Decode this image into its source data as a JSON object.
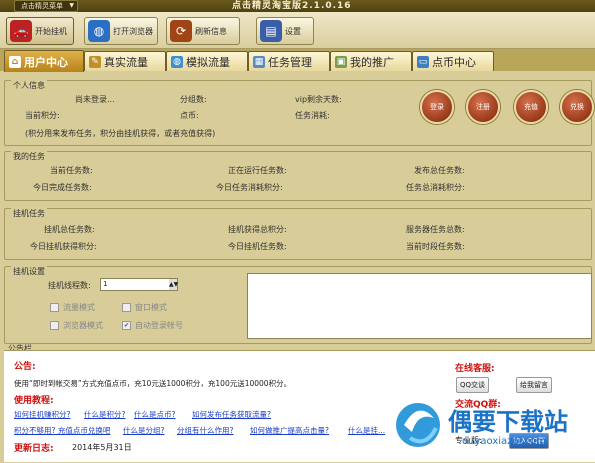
{
  "titlebar": {
    "menu_label": "点击精灵菜单",
    "title": "点击精灵淘宝版2.1.0.16"
  },
  "toolbar": {
    "buttons": [
      "开始挂机",
      "打开浏览器",
      "刷新信息",
      "设置"
    ]
  },
  "tabs": [
    "用户中心",
    "真实流量",
    "模拟流量",
    "任务管理",
    "我的推广",
    "点币中心"
  ],
  "personal": {
    "title": "个人信息",
    "login_status": "尚未登录...",
    "group": "分组数:",
    "vip": "vip剩余天数:",
    "points": "当前积分:",
    "coins": "点币:",
    "task_consume": "任务消耗:",
    "note": "(积分用来发布任务，积分由挂机获得，或者充值获得)",
    "circles": [
      "登录",
      "注册",
      "充值",
      "兑换"
    ]
  },
  "mytasks": {
    "title": "我的任务",
    "cur_tasks": "当前任务数:",
    "running": "正在运行任务数:",
    "published_total": "发布总任务数:",
    "today_done": "今日完成任务数:",
    "today_consume": "今日任务消耗积分:",
    "total_consume": "任务总消耗积分:"
  },
  "hang": {
    "title": "挂机任务",
    "total_tasks": "挂机总任务数:",
    "total_points": "挂机获得总积分:",
    "server_total": "服务器任务总数:",
    "today_points": "今日挂机获得积分:",
    "today_tasks": "今日挂机任务数:",
    "cur_time": "当前时段任务数:"
  },
  "settings": {
    "title": "挂机设置",
    "threads_label": "挂机线程数:",
    "threads_value": "1",
    "opts": [
      "流量模式",
      "窗口模式",
      "浏览器模式",
      "自动登录帐号"
    ]
  },
  "notice": {
    "title": "公告栏",
    "gonggao_title": "公告:",
    "gonggao_text": "使用“即时到帐交易”方式充值点币，充10元送1000积分，充100元送10000积分。",
    "tutorial_title": "使用教程:",
    "links1": [
      "如何挂机赚积分?",
      "什么是积分?",
      "什么是点币?",
      "如何发布任务获取流量?"
    ],
    "links2": [
      "积分不够用? 充值点币兑换吧",
      "什么是分组?",
      "分组有什么作用?",
      "如何做推广提高点击量?",
      "什么是挂..."
    ],
    "update_title": "更新日志:",
    "update_date": "2014年5月31日",
    "service_title": "在线客服:",
    "qq_chat": "QQ交谈",
    "leave_msg": "给我留言",
    "group_title": "交流QQ群:",
    "pro_label": "专业版:",
    "join_qq": "加入QQ群"
  },
  "watermark": {
    "text": "偶要下载站",
    "url": "ouyaoxiazai.com"
  }
}
